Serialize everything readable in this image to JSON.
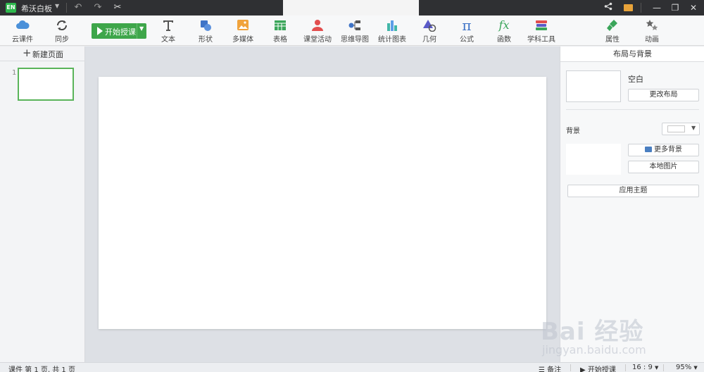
{
  "titlebar": {
    "logo_text": "EN",
    "app_title": "希沃白板"
  },
  "ribbon": {
    "cloud_label": "云课件",
    "sync_label": "同步",
    "start_label": "开始授课",
    "tools": [
      {
        "label": "文本"
      },
      {
        "label": "形状"
      },
      {
        "label": "多媒体"
      },
      {
        "label": "表格"
      },
      {
        "label": "课堂活动"
      },
      {
        "label": "思维导图"
      },
      {
        "label": "统计图表"
      },
      {
        "label": "几何"
      },
      {
        "label": "公式"
      },
      {
        "label": "函数"
      },
      {
        "label": "学科工具"
      }
    ],
    "properties_label": "属性",
    "animation_label": "动画"
  },
  "left_panel": {
    "new_page_label": "新建页面",
    "slide_number": "1"
  },
  "right_panel": {
    "header": "布局与背景",
    "layout_name": "空白",
    "change_layout": "更改布局",
    "background_label": "背景",
    "more_backgrounds": "更多背景",
    "local_image": "本地图片",
    "apply_theme": "应用主题"
  },
  "statusbar": {
    "page_info": "课件 第 1 页, 共 1 页",
    "notes": "备注",
    "start": "开始授课",
    "ratio": "16 : 9",
    "zoom": "95%"
  },
  "watermark": {
    "logo": "Bai 经验",
    "url": "jingyan.baidu.com"
  },
  "colors": {
    "accent_green": "#3ea64a",
    "titlebar": "#2f3033"
  }
}
